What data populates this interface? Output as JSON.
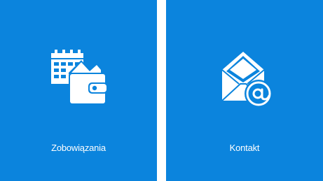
{
  "colors": {
    "tile_background": "#0b84dd",
    "icon_foreground": "#ffffff"
  },
  "tiles": [
    {
      "label": "Zobowiązania",
      "icon": "calendar-wallet-icon"
    },
    {
      "label": "Kontakt",
      "icon": "envelope-at-icon"
    }
  ]
}
